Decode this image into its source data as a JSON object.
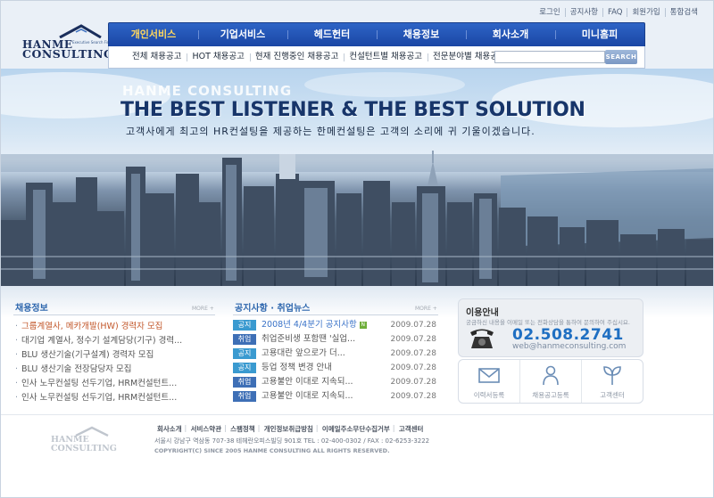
{
  "brand": {
    "line1": "HANME",
    "line2": "CONSULTING",
    "tagline": "Executive Search Firm"
  },
  "util_links": [
    "로그인",
    "공지사항",
    "FAQ",
    "회원가입",
    "통합검색"
  ],
  "gnb": [
    {
      "label": "개인서비스",
      "active": true
    },
    {
      "label": "기업서비스",
      "active": false
    },
    {
      "label": "헤드헌터",
      "active": false
    },
    {
      "label": "채용정보",
      "active": false
    },
    {
      "label": "회사소개",
      "active": false
    },
    {
      "label": "미니홈피",
      "active": false
    }
  ],
  "subnav": [
    "전체 채용공고",
    "HOT 채용공고",
    "현재 진행중인 채용공고",
    "컨설턴트별 채용공고",
    "전문분야별 채용공고"
  ],
  "search": {
    "value": "",
    "button": "SEARCH"
  },
  "hero": {
    "sub": "HANME CONSULTING",
    "main": "THE BEST LISTENER & THE BEST SOLUTION",
    "kor": "고객사에게 최고의 HR컨설팅을 제공하는 한메컨설팅은 고객의 소리에 귀 기울이겠습니다."
  },
  "jobs": {
    "title": "채용정보",
    "more": "MORE +",
    "items": [
      {
        "text": "그룹계열사, 메카개발(HW) 경력자 모집",
        "hi": true
      },
      {
        "text": "대기업 계열사, 정수기 설계담당(기구) 경력...",
        "hi": false
      },
      {
        "text": "BLU 생산기술(기구설계) 경력자 모집",
        "hi": false
      },
      {
        "text": "BLU 생산기술 전장담당자 모집",
        "hi": false
      },
      {
        "text": "인사 노무컨설팅 선두기업, HRM컨설턴트...",
        "hi": false
      },
      {
        "text": "인사 노무컨설팅 선두기업, HRM컨설턴트...",
        "hi": false
      }
    ]
  },
  "news": {
    "title": "공지사항 · 취업뉴스",
    "more": "MORE +",
    "items": [
      {
        "tag": "공지",
        "kind": "a",
        "text": "2008년 4/4분기 공지사항",
        "date": "2009.07.28",
        "new": "N",
        "hi": true
      },
      {
        "tag": "취업",
        "kind": "b",
        "text": "취업준비생 포함땐 '실업...",
        "date": "2009.07.28",
        "new": "",
        "hi": false
      },
      {
        "tag": "공지",
        "kind": "a",
        "text": "고용대란 앞으로가 더...",
        "date": "2009.07.28",
        "new": "",
        "hi": false
      },
      {
        "tag": "공지",
        "kind": "a",
        "text": "등업 정책 변경 안내",
        "date": "2009.07.28",
        "new": "",
        "hi": false
      },
      {
        "tag": "취업",
        "kind": "b",
        "text": "고용불안 이대로 지속되...",
        "date": "2009.07.28",
        "new": "",
        "hi": false
      },
      {
        "tag": "취업",
        "kind": "b",
        "text": "고용불안 이대로 지속되...",
        "date": "2009.07.28",
        "new": "",
        "hi": false
      }
    ]
  },
  "info": {
    "title": "이용안내",
    "text": "궁금하신 내용을 이메일 또는 전화상담을 통하여 문의하여 주십시요.",
    "phone": "02.508.2741",
    "email": "web@hanmeconsulting.com"
  },
  "quick": [
    {
      "label": "이력서등록",
      "icon": "envelope-icon"
    },
    {
      "label": "채용공고등록",
      "icon": "person-icon"
    },
    {
      "label": "고객센터",
      "icon": "sprout-icon"
    }
  ],
  "footer": {
    "links": [
      "회사소개",
      "서비스약관",
      "스팸정책",
      "개인정보취급방침",
      "이메일주소무단수집거부",
      "고객센터"
    ],
    "address": "서울시 강남구 역삼동 707-38 테헤란오피스빌딩 901호 TEL : 02-400-0302 / FAX : 02-6253-3222",
    "copyright": "COPYRIGHT(C) SINCE 2005 HANME CONSULTING ALL RIGHTS RESERVED."
  },
  "colors": {
    "nav": "#1a46a4",
    "active": "#ffd75e",
    "accent": "#1f6fc2"
  }
}
